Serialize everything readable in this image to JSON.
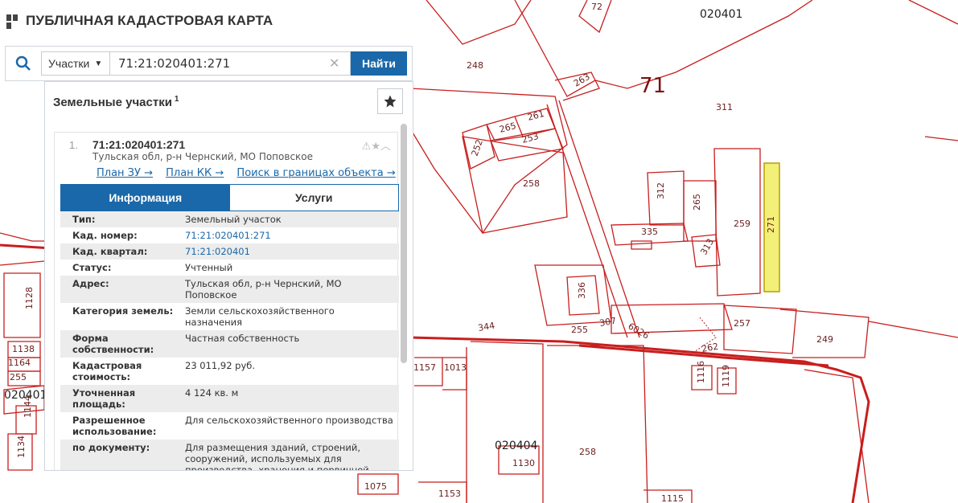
{
  "app": {
    "title": "ПУБЛИЧНАЯ КАДАСТРОВАЯ КАРТА"
  },
  "search": {
    "type_label": "Участки",
    "query": "71:21:020401:271",
    "find_label": "Найти"
  },
  "panel": {
    "title": "Земельные участки",
    "count": "1",
    "result": {
      "number": "1.",
      "id": "71:21:020401:271",
      "address": "Тульская обл, р-н Чернский, МО Поповское",
      "links": [
        "План ЗУ →",
        "План КК →",
        "Поиск в границах объекта →"
      ]
    },
    "tabs": [
      {
        "label": "Информация"
      },
      {
        "label": "Услуги"
      }
    ],
    "info_rows": [
      {
        "k": "Тип:",
        "v": "Земельный участок"
      },
      {
        "k": "Кад. номер:",
        "v": "71:21:020401:271"
      },
      {
        "k": "Кад. квартал:",
        "v": "71:21:020401"
      },
      {
        "k": "Статус:",
        "v": "Учтенный"
      },
      {
        "k": "Адрес:",
        "v": "Тульская обл, р-н Чернский, МО Поповское"
      },
      {
        "k": "Категория земель:",
        "v": "Земли сельскохозяйственного назначения"
      },
      {
        "k": "Форма собственности:",
        "v": "Частная собственность"
      },
      {
        "k": "Кадастровая стоимость:",
        "v": "23 011,92 руб."
      },
      {
        "k": "Уточненная площадь:",
        "v": "4 124 кв. м"
      },
      {
        "k": "Разрешенное использование:",
        "v": "Для сельскохозяйственного производства"
      },
      {
        "k": "по документу:",
        "v": "Для размещения зданий, строений, сооружений, используемых для производства, хранения и первичной"
      }
    ]
  },
  "map": {
    "labels": [
      "72",
      "020401",
      "248",
      "71",
      "263",
      "311",
      "261",
      "265",
      "253",
      "252",
      "258",
      "312",
      "265",
      "259",
      "271",
      "335",
      "313",
      "336",
      "344",
      "255",
      "307",
      "6026",
      "257",
      "262",
      "249",
      "1157",
      "1013",
      "1116",
      "1119",
      "020404",
      "1130",
      "258",
      "1153",
      "1115",
      "1075",
      "1128",
      "1138",
      "1164",
      "255",
      "020401",
      "1144",
      "1134"
    ],
    "colors": {
      "parcel_line": "#c81e1e",
      "highlight_fill": "#f3f07a",
      "highlight_stroke": "#b5a100"
    }
  }
}
